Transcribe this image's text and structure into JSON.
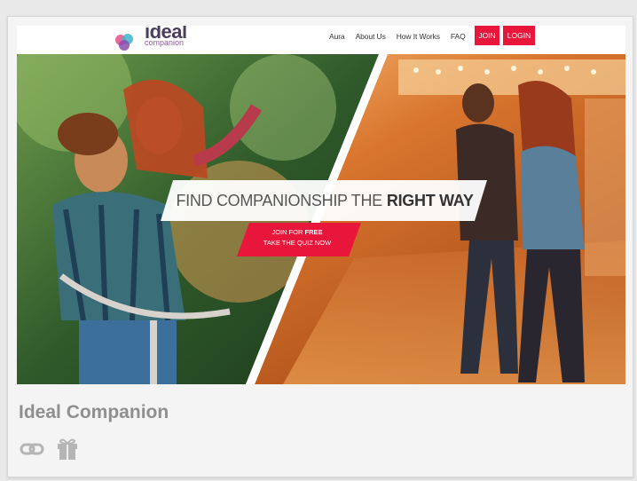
{
  "site": {
    "logo_text": "ideal",
    "logo_sub": "companion",
    "nav": [
      "Aura",
      "About Us",
      "How It Works",
      "FAQ"
    ],
    "join_label": "JOIN",
    "login_label": "LOGIN"
  },
  "hero": {
    "tagline_light": "FIND COMPANIONSHIP THE",
    "tagline_bold": "RIGHT WAY",
    "cta_line1": "JOIN FOR",
    "cta_line1_bold": "FREE",
    "cta_line2": "TAKE THE QUIZ NOW"
  },
  "card": {
    "title": "Ideal Companion",
    "icons": [
      "link-icon",
      "gift-icon"
    ]
  },
  "colors": {
    "brand_red": "#e8163a",
    "title_gray": "#8f8f8f"
  }
}
